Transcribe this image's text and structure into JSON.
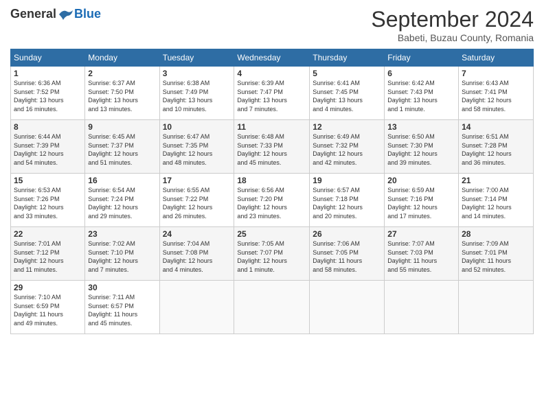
{
  "header": {
    "logo_general": "General",
    "logo_blue": "Blue",
    "month_title": "September 2024",
    "subtitle": "Babeti, Buzau County, Romania"
  },
  "weekdays": [
    "Sunday",
    "Monday",
    "Tuesday",
    "Wednesday",
    "Thursday",
    "Friday",
    "Saturday"
  ],
  "weeks": [
    [
      {
        "day": "1",
        "info": "Sunrise: 6:36 AM\nSunset: 7:52 PM\nDaylight: 13 hours\nand 16 minutes."
      },
      {
        "day": "2",
        "info": "Sunrise: 6:37 AM\nSunset: 7:50 PM\nDaylight: 13 hours\nand 13 minutes."
      },
      {
        "day": "3",
        "info": "Sunrise: 6:38 AM\nSunset: 7:49 PM\nDaylight: 13 hours\nand 10 minutes."
      },
      {
        "day": "4",
        "info": "Sunrise: 6:39 AM\nSunset: 7:47 PM\nDaylight: 13 hours\nand 7 minutes."
      },
      {
        "day": "5",
        "info": "Sunrise: 6:41 AM\nSunset: 7:45 PM\nDaylight: 13 hours\nand 4 minutes."
      },
      {
        "day": "6",
        "info": "Sunrise: 6:42 AM\nSunset: 7:43 PM\nDaylight: 13 hours\nand 1 minute."
      },
      {
        "day": "7",
        "info": "Sunrise: 6:43 AM\nSunset: 7:41 PM\nDaylight: 12 hours\nand 58 minutes."
      }
    ],
    [
      {
        "day": "8",
        "info": "Sunrise: 6:44 AM\nSunset: 7:39 PM\nDaylight: 12 hours\nand 54 minutes."
      },
      {
        "day": "9",
        "info": "Sunrise: 6:45 AM\nSunset: 7:37 PM\nDaylight: 12 hours\nand 51 minutes."
      },
      {
        "day": "10",
        "info": "Sunrise: 6:47 AM\nSunset: 7:35 PM\nDaylight: 12 hours\nand 48 minutes."
      },
      {
        "day": "11",
        "info": "Sunrise: 6:48 AM\nSunset: 7:33 PM\nDaylight: 12 hours\nand 45 minutes."
      },
      {
        "day": "12",
        "info": "Sunrise: 6:49 AM\nSunset: 7:32 PM\nDaylight: 12 hours\nand 42 minutes."
      },
      {
        "day": "13",
        "info": "Sunrise: 6:50 AM\nSunset: 7:30 PM\nDaylight: 12 hours\nand 39 minutes."
      },
      {
        "day": "14",
        "info": "Sunrise: 6:51 AM\nSunset: 7:28 PM\nDaylight: 12 hours\nand 36 minutes."
      }
    ],
    [
      {
        "day": "15",
        "info": "Sunrise: 6:53 AM\nSunset: 7:26 PM\nDaylight: 12 hours\nand 33 minutes."
      },
      {
        "day": "16",
        "info": "Sunrise: 6:54 AM\nSunset: 7:24 PM\nDaylight: 12 hours\nand 29 minutes."
      },
      {
        "day": "17",
        "info": "Sunrise: 6:55 AM\nSunset: 7:22 PM\nDaylight: 12 hours\nand 26 minutes."
      },
      {
        "day": "18",
        "info": "Sunrise: 6:56 AM\nSunset: 7:20 PM\nDaylight: 12 hours\nand 23 minutes."
      },
      {
        "day": "19",
        "info": "Sunrise: 6:57 AM\nSunset: 7:18 PM\nDaylight: 12 hours\nand 20 minutes."
      },
      {
        "day": "20",
        "info": "Sunrise: 6:59 AM\nSunset: 7:16 PM\nDaylight: 12 hours\nand 17 minutes."
      },
      {
        "day": "21",
        "info": "Sunrise: 7:00 AM\nSunset: 7:14 PM\nDaylight: 12 hours\nand 14 minutes."
      }
    ],
    [
      {
        "day": "22",
        "info": "Sunrise: 7:01 AM\nSunset: 7:12 PM\nDaylight: 12 hours\nand 11 minutes."
      },
      {
        "day": "23",
        "info": "Sunrise: 7:02 AM\nSunset: 7:10 PM\nDaylight: 12 hours\nand 7 minutes."
      },
      {
        "day": "24",
        "info": "Sunrise: 7:04 AM\nSunset: 7:08 PM\nDaylight: 12 hours\nand 4 minutes."
      },
      {
        "day": "25",
        "info": "Sunrise: 7:05 AM\nSunset: 7:07 PM\nDaylight: 12 hours\nand 1 minute."
      },
      {
        "day": "26",
        "info": "Sunrise: 7:06 AM\nSunset: 7:05 PM\nDaylight: 11 hours\nand 58 minutes."
      },
      {
        "day": "27",
        "info": "Sunrise: 7:07 AM\nSunset: 7:03 PM\nDaylight: 11 hours\nand 55 minutes."
      },
      {
        "day": "28",
        "info": "Sunrise: 7:09 AM\nSunset: 7:01 PM\nDaylight: 11 hours\nand 52 minutes."
      }
    ],
    [
      {
        "day": "29",
        "info": "Sunrise: 7:10 AM\nSunset: 6:59 PM\nDaylight: 11 hours\nand 49 minutes."
      },
      {
        "day": "30",
        "info": "Sunrise: 7:11 AM\nSunset: 6:57 PM\nDaylight: 11 hours\nand 45 minutes."
      },
      {
        "day": "",
        "info": ""
      },
      {
        "day": "",
        "info": ""
      },
      {
        "day": "",
        "info": ""
      },
      {
        "day": "",
        "info": ""
      },
      {
        "day": "",
        "info": ""
      }
    ]
  ]
}
